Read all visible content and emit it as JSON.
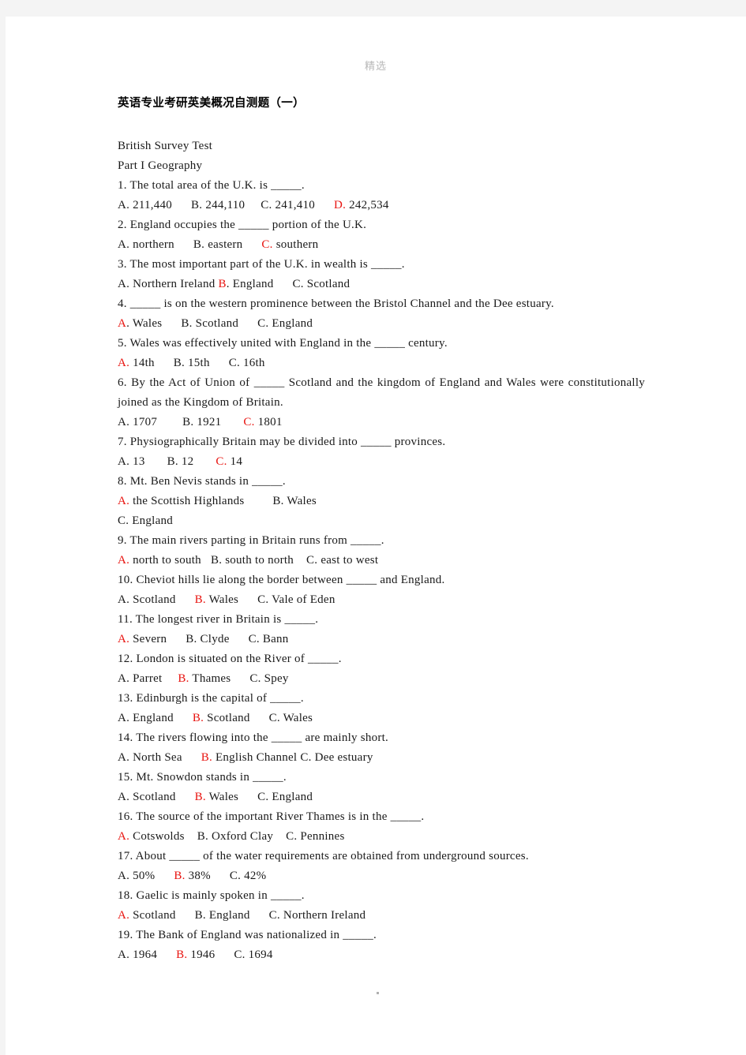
{
  "page": {
    "watermark": "精选",
    "title": "英语专业考研英美概况自测题（一）",
    "subtitle": "British Survey Test",
    "part_heading": "Part I Geography",
    "footer_marker": "."
  },
  "colors": {
    "answer_red": "#e8130f",
    "text_black": "#1a1a1a",
    "watermark_gray": "#b8b8b8",
    "page_background": "#ffffff",
    "canvas_background": "#f4f4f4"
  },
  "questions": [
    {
      "number": "1.",
      "stem": "1. The total area of the U.K. is _____.",
      "options_lines": [
        [
          {
            "t": "A.",
            "red": false
          },
          {
            "t": " 211,440",
            "red": false
          },
          {
            "t": "      ",
            "red": false
          },
          {
            "t": "B.",
            "red": false
          },
          {
            "t": " 244,110",
            "red": false
          },
          {
            "t": "     ",
            "red": false
          },
          {
            "t": "C.",
            "red": false
          },
          {
            "t": " 241,410",
            "red": false
          },
          {
            "t": "      ",
            "red": false
          },
          {
            "t": "D.",
            "red": true
          },
          {
            "t": " 242,534",
            "red": false
          }
        ]
      ]
    },
    {
      "number": "2.",
      "stem": "2. England occupies the _____ portion of the U.K.",
      "options_lines": [
        [
          {
            "t": "A.",
            "red": false
          },
          {
            "t": " northern",
            "red": false
          },
          {
            "t": "      ",
            "red": false
          },
          {
            "t": "B.",
            "red": false
          },
          {
            "t": " eastern",
            "red": false
          },
          {
            "t": "      ",
            "red": false
          },
          {
            "t": "C.",
            "red": true
          },
          {
            "t": " southern",
            "red": false
          }
        ]
      ]
    },
    {
      "number": "3.",
      "stem": "3. The most important part of the U.K. in wealth is _____.",
      "options_lines": [
        [
          {
            "t": "A.",
            "red": false
          },
          {
            "t": " Northern Ireland ",
            "red": false
          },
          {
            "t": "B",
            "red": true
          },
          {
            "t": ". England",
            "red": false
          },
          {
            "t": "      ",
            "red": false
          },
          {
            "t": "C.",
            "red": false
          },
          {
            "t": " Scotland",
            "red": false
          }
        ]
      ]
    },
    {
      "number": "4.",
      "stem": "4. _____ is on the western prominence between the Bristol Channel and the Dee estuary.",
      "options_lines": [
        [
          {
            "t": "A",
            "red": true
          },
          {
            "t": ". Wales",
            "red": false
          },
          {
            "t": "      ",
            "red": false
          },
          {
            "t": "B.",
            "red": false
          },
          {
            "t": " Scotland",
            "red": false
          },
          {
            "t": "      ",
            "red": false
          },
          {
            "t": "C.",
            "red": false
          },
          {
            "t": " England",
            "red": false
          }
        ]
      ]
    },
    {
      "number": "5.",
      "stem": "5. Wales was effectively united with England in the _____ century.",
      "options_lines": [
        [
          {
            "t": "A.",
            "red": true
          },
          {
            "t": " 14th",
            "red": false
          },
          {
            "t": "      ",
            "red": false
          },
          {
            "t": "B.",
            "red": false
          },
          {
            "t": " 15th",
            "red": false
          },
          {
            "t": "      ",
            "red": false
          },
          {
            "t": "C.",
            "red": false
          },
          {
            "t": " 16th",
            "red": false
          }
        ]
      ]
    },
    {
      "number": "6.",
      "stem": "6. By the Act of Union of _____ Scotland and the kingdom of England and Wales were constitutionally joined as the Kingdom of Britain.",
      "justify": true,
      "options_lines": [
        [
          {
            "t": "A.",
            "red": false
          },
          {
            "t": " 1707",
            "red": false
          },
          {
            "t": "        ",
            "red": false
          },
          {
            "t": "B.",
            "red": false
          },
          {
            "t": " 1921",
            "red": false
          },
          {
            "t": "       ",
            "red": false
          },
          {
            "t": "C.",
            "red": true
          },
          {
            "t": " 1801",
            "red": false
          }
        ]
      ]
    },
    {
      "number": "7.",
      "stem": "7. Physiographically Britain may be divided into _____ provinces.",
      "options_lines": [
        [
          {
            "t": "A.",
            "red": false
          },
          {
            "t": " 13",
            "red": false
          },
          {
            "t": "       ",
            "red": false
          },
          {
            "t": "B.",
            "red": false
          },
          {
            "t": " 12",
            "red": false
          },
          {
            "t": "       ",
            "red": false
          },
          {
            "t": "C.",
            "red": true
          },
          {
            "t": " 14",
            "red": false
          }
        ]
      ]
    },
    {
      "number": "8.",
      "stem": "8. Mt. Ben Nevis stands in _____.",
      "options_lines": [
        [
          {
            "t": "A.",
            "red": true
          },
          {
            "t": " the Scottish Highlands",
            "red": false
          },
          {
            "t": "         ",
            "red": false
          },
          {
            "t": "B.",
            "red": false
          },
          {
            "t": " Wales",
            "red": false
          }
        ],
        [
          {
            "t": "C.",
            "red": false
          },
          {
            "t": " England",
            "red": false
          }
        ]
      ]
    },
    {
      "number": "9.",
      "stem": "9. The main rivers parting in Britain runs from _____.",
      "options_lines": [
        [
          {
            "t": "A.",
            "red": true
          },
          {
            "t": " north to south",
            "red": false
          },
          {
            "t": "   ",
            "red": false
          },
          {
            "t": "B.",
            "red": false
          },
          {
            "t": " south to north",
            "red": false
          },
          {
            "t": "    ",
            "red": false
          },
          {
            "t": "C.",
            "red": false
          },
          {
            "t": " east to west",
            "red": false
          }
        ]
      ]
    },
    {
      "number": "10.",
      "stem": "10. Cheviot hills lie along the border between _____ and England.",
      "options_lines": [
        [
          {
            "t": "A.",
            "red": false
          },
          {
            "t": " Scotland",
            "red": false
          },
          {
            "t": "      ",
            "red": false
          },
          {
            "t": "B.",
            "red": true
          },
          {
            "t": " Wales",
            "red": false
          },
          {
            "t": "      ",
            "red": false
          },
          {
            "t": "C.",
            "red": false
          },
          {
            "t": " Vale of Eden",
            "red": false
          }
        ]
      ]
    },
    {
      "number": "11.",
      "stem": "11. The longest river in Britain is _____.",
      "options_lines": [
        [
          {
            "t": "A.",
            "red": true
          },
          {
            "t": " Severn",
            "red": false
          },
          {
            "t": "      ",
            "red": false
          },
          {
            "t": "B.",
            "red": false
          },
          {
            "t": " Clyde",
            "red": false
          },
          {
            "t": "      ",
            "red": false
          },
          {
            "t": "C.",
            "red": false
          },
          {
            "t": " Bann",
            "red": false
          }
        ]
      ]
    },
    {
      "number": "12.",
      "stem": "12. London is situated on the River of _____.",
      "options_lines": [
        [
          {
            "t": "A.",
            "red": false
          },
          {
            "t": " Parret",
            "red": false
          },
          {
            "t": "     ",
            "red": false
          },
          {
            "t": "B.",
            "red": true
          },
          {
            "t": " Thames",
            "red": false
          },
          {
            "t": "      ",
            "red": false
          },
          {
            "t": "C.",
            "red": false
          },
          {
            "t": " Spey",
            "red": false
          }
        ]
      ]
    },
    {
      "number": "13.",
      "stem": "13. Edinburgh is the capital of _____.",
      "options_lines": [
        [
          {
            "t": "A.",
            "red": false
          },
          {
            "t": " England",
            "red": false
          },
          {
            "t": "      ",
            "red": false
          },
          {
            "t": "B.",
            "red": true
          },
          {
            "t": " Scotland",
            "red": false
          },
          {
            "t": "      ",
            "red": false
          },
          {
            "t": "C.",
            "red": false
          },
          {
            "t": " Wales",
            "red": false
          }
        ]
      ]
    },
    {
      "number": "14.",
      "stem": "14. The rivers flowing into the _____ are mainly short.",
      "options_lines": [
        [
          {
            "t": "A.",
            "red": false
          },
          {
            "t": " North Sea",
            "red": false
          },
          {
            "t": "      ",
            "red": false
          },
          {
            "t": "B.",
            "red": true
          },
          {
            "t": " English Channel",
            "red": false
          },
          {
            "t": " ",
            "red": false
          },
          {
            "t": "C.",
            "red": false
          },
          {
            "t": " Dee estuary",
            "red": false
          }
        ]
      ]
    },
    {
      "number": "15.",
      "stem": "15. Mt. Snowdon stands in _____.",
      "options_lines": [
        [
          {
            "t": "A.",
            "red": false
          },
          {
            "t": " Scotland",
            "red": false
          },
          {
            "t": "      ",
            "red": false
          },
          {
            "t": "B.",
            "red": true
          },
          {
            "t": " Wales",
            "red": false
          },
          {
            "t": "      ",
            "red": false
          },
          {
            "t": "C.",
            "red": false
          },
          {
            "t": " England",
            "red": false
          }
        ]
      ]
    },
    {
      "number": "16.",
      "stem": "16. The source of the important River Thames is in the _____.",
      "options_lines": [
        [
          {
            "t": "A.",
            "red": true
          },
          {
            "t": " Cotswolds",
            "red": false
          },
          {
            "t": "    ",
            "red": false
          },
          {
            "t": "B.",
            "red": false
          },
          {
            "t": " Oxford Clay",
            "red": false
          },
          {
            "t": "    ",
            "red": false
          },
          {
            "t": "C.",
            "red": false
          },
          {
            "t": " Pennines",
            "red": false
          }
        ]
      ]
    },
    {
      "number": "17.",
      "stem": "17. About _____ of the water requirements are obtained from underground sources.",
      "options_lines": [
        [
          {
            "t": "A.",
            "red": false
          },
          {
            "t": " 50%",
            "red": false
          },
          {
            "t": "      ",
            "red": false
          },
          {
            "t": "B.",
            "red": true
          },
          {
            "t": " 38%",
            "red": false
          },
          {
            "t": "      ",
            "red": false
          },
          {
            "t": "C.",
            "red": false
          },
          {
            "t": " 42%",
            "red": false
          }
        ]
      ]
    },
    {
      "number": "18.",
      "stem": "18. Gaelic is mainly spoken in _____.",
      "options_lines": [
        [
          {
            "t": "A.",
            "red": true
          },
          {
            "t": " Scotland",
            "red": false
          },
          {
            "t": "      ",
            "red": false
          },
          {
            "t": "B.",
            "red": false
          },
          {
            "t": " England",
            "red": false
          },
          {
            "t": "      ",
            "red": false
          },
          {
            "t": "C.",
            "red": false
          },
          {
            "t": " Northern Ireland",
            "red": false
          }
        ]
      ]
    },
    {
      "number": "19.",
      "stem": "19. The Bank of England was nationalized in _____.",
      "options_lines": [
        [
          {
            "t": "A.",
            "red": false
          },
          {
            "t": " 1964",
            "red": false
          },
          {
            "t": "      ",
            "red": false
          },
          {
            "t": "B.",
            "red": true
          },
          {
            "t": " 1946",
            "red": false
          },
          {
            "t": "      ",
            "red": false
          },
          {
            "t": "C.",
            "red": false
          },
          {
            "t": " 1694",
            "red": false
          }
        ]
      ]
    }
  ]
}
